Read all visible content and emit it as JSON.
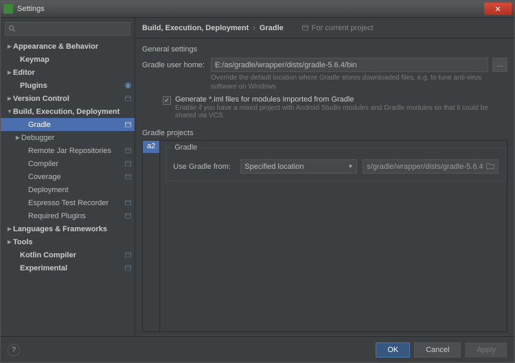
{
  "window": {
    "title": "Settings"
  },
  "search": {
    "placeholder": ""
  },
  "tree": [
    {
      "label": "Appearance & Behavior",
      "bold": true,
      "arrow": "▶",
      "indent": 8
    },
    {
      "label": "Keymap",
      "bold": true,
      "arrow": "",
      "indent": 18
    },
    {
      "label": "Editor",
      "bold": true,
      "arrow": "▶",
      "indent": 8
    },
    {
      "label": "Plugins",
      "bold": true,
      "arrow": "",
      "indent": 18,
      "badge_info": true
    },
    {
      "label": "Version Control",
      "bold": true,
      "arrow": "▶",
      "indent": 8,
      "badge_proj": true
    },
    {
      "label": "Build, Execution, Deployment",
      "bold": true,
      "arrow": "▼",
      "indent": 8
    },
    {
      "label": "Gradle",
      "bold": false,
      "arrow": "",
      "indent": 30,
      "selected": true,
      "badge_proj": true
    },
    {
      "label": "Debugger",
      "bold": false,
      "arrow": "▶",
      "indent": 20
    },
    {
      "label": "Remote Jar Repositories",
      "bold": false,
      "arrow": "",
      "indent": 30,
      "badge_proj": true
    },
    {
      "label": "Compiler",
      "bold": false,
      "arrow": "",
      "indent": 30,
      "badge_proj": true
    },
    {
      "label": "Coverage",
      "bold": false,
      "arrow": "",
      "indent": 30,
      "badge_proj": true
    },
    {
      "label": "Deployment",
      "bold": false,
      "arrow": "",
      "indent": 30
    },
    {
      "label": "Espresso Test Recorder",
      "bold": false,
      "arrow": "",
      "indent": 30,
      "badge_proj": true
    },
    {
      "label": "Required Plugins",
      "bold": false,
      "arrow": "",
      "indent": 30,
      "badge_proj": true
    },
    {
      "label": "Languages & Frameworks",
      "bold": true,
      "arrow": "▶",
      "indent": 8
    },
    {
      "label": "Tools",
      "bold": true,
      "arrow": "▶",
      "indent": 8
    },
    {
      "label": "Kotlin Compiler",
      "bold": true,
      "arrow": "",
      "indent": 18,
      "badge_proj": true
    },
    {
      "label": "Experimental",
      "bold": true,
      "arrow": "",
      "indent": 18,
      "badge_proj": true
    }
  ],
  "breadcrumb": {
    "root": "Build, Execution, Deployment",
    "sep": "›",
    "leaf": "Gradle",
    "hint": "For current project"
  },
  "general": {
    "section": "General settings",
    "home_label": "Gradle user home:",
    "home_value": "E:/as/gradle/wrapper/dists/gradle-5.6.4/bin",
    "home_hint": "Override the default location where Gradle stores downloaded files, e.g. to tune anti-virus software on Windows",
    "cb_label": "Generate *.iml files for modules imported from Gradle",
    "cb_hint": "Enable if you have a mixed project with Android Studio modules and Gradle modules so that it could be shared via VCS."
  },
  "projects": {
    "section": "Gradle projects",
    "items": [
      "a2"
    ],
    "frame_title": "Gradle",
    "use_from_label": "Use Gradle from:",
    "use_from_value": "Specified location",
    "location": "s/gradle/wrapper/dists/gradle-5.6.4"
  },
  "footer": {
    "ok": "OK",
    "cancel": "Cancel",
    "apply": "Apply"
  }
}
